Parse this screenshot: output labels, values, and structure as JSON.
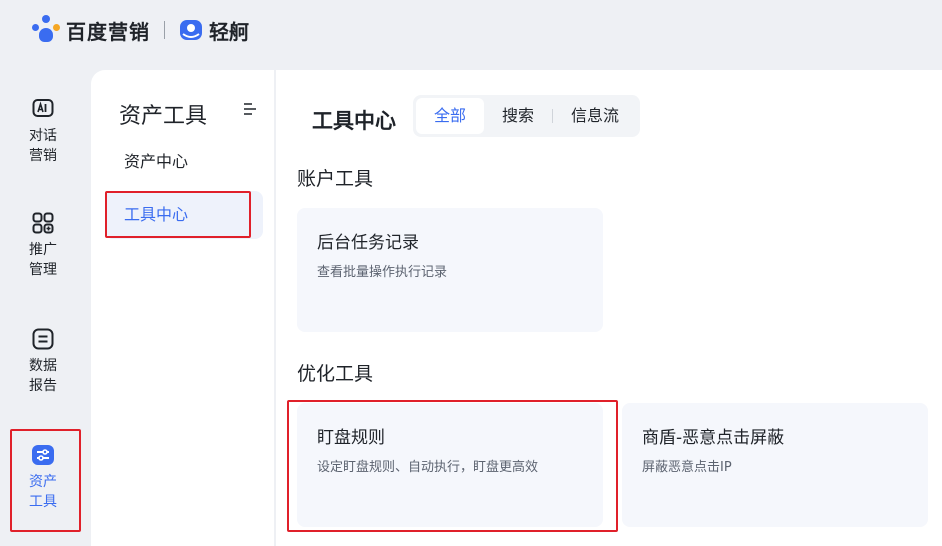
{
  "brand": {
    "name": "百度营销",
    "product": "轻舸"
  },
  "rail": {
    "items": [
      {
        "label_line1": "对话",
        "label_line2": "营销",
        "icon": "ai-chat-icon"
      },
      {
        "label_line1": "推广",
        "label_line2": "管理",
        "icon": "grid-plus-icon"
      },
      {
        "label_line1": "数据",
        "label_line2": "报告",
        "icon": "report-icon"
      },
      {
        "label_line1": "资产",
        "label_line2": "工具",
        "icon": "tools-slider-icon",
        "active": true
      }
    ]
  },
  "subpanel": {
    "title": "资产工具",
    "items": [
      {
        "label": "资产中心"
      },
      {
        "label": "工具中心",
        "active": true
      }
    ]
  },
  "main": {
    "title": "工具中心",
    "tabs": [
      {
        "label": "全部",
        "active": true
      },
      {
        "label": "搜索"
      },
      {
        "label": "信息流"
      }
    ],
    "sections": [
      {
        "title": "账户工具",
        "cards": [
          {
            "title": "后台任务记录",
            "desc": "查看批量操作执行记录"
          }
        ]
      },
      {
        "title": "优化工具",
        "cards": [
          {
            "title": "盯盘规则",
            "desc": "设定盯盘规则、自动执行，盯盘更高效"
          },
          {
            "title": "商盾-恶意点击屏蔽",
            "desc": "屏蔽恶意点击IP"
          }
        ]
      }
    ]
  },
  "colors": {
    "accent": "#3a6cf0",
    "highlight_box": "#e0202a",
    "page_bg": "#eef0f4",
    "card_bg": "#f5f7fc"
  }
}
